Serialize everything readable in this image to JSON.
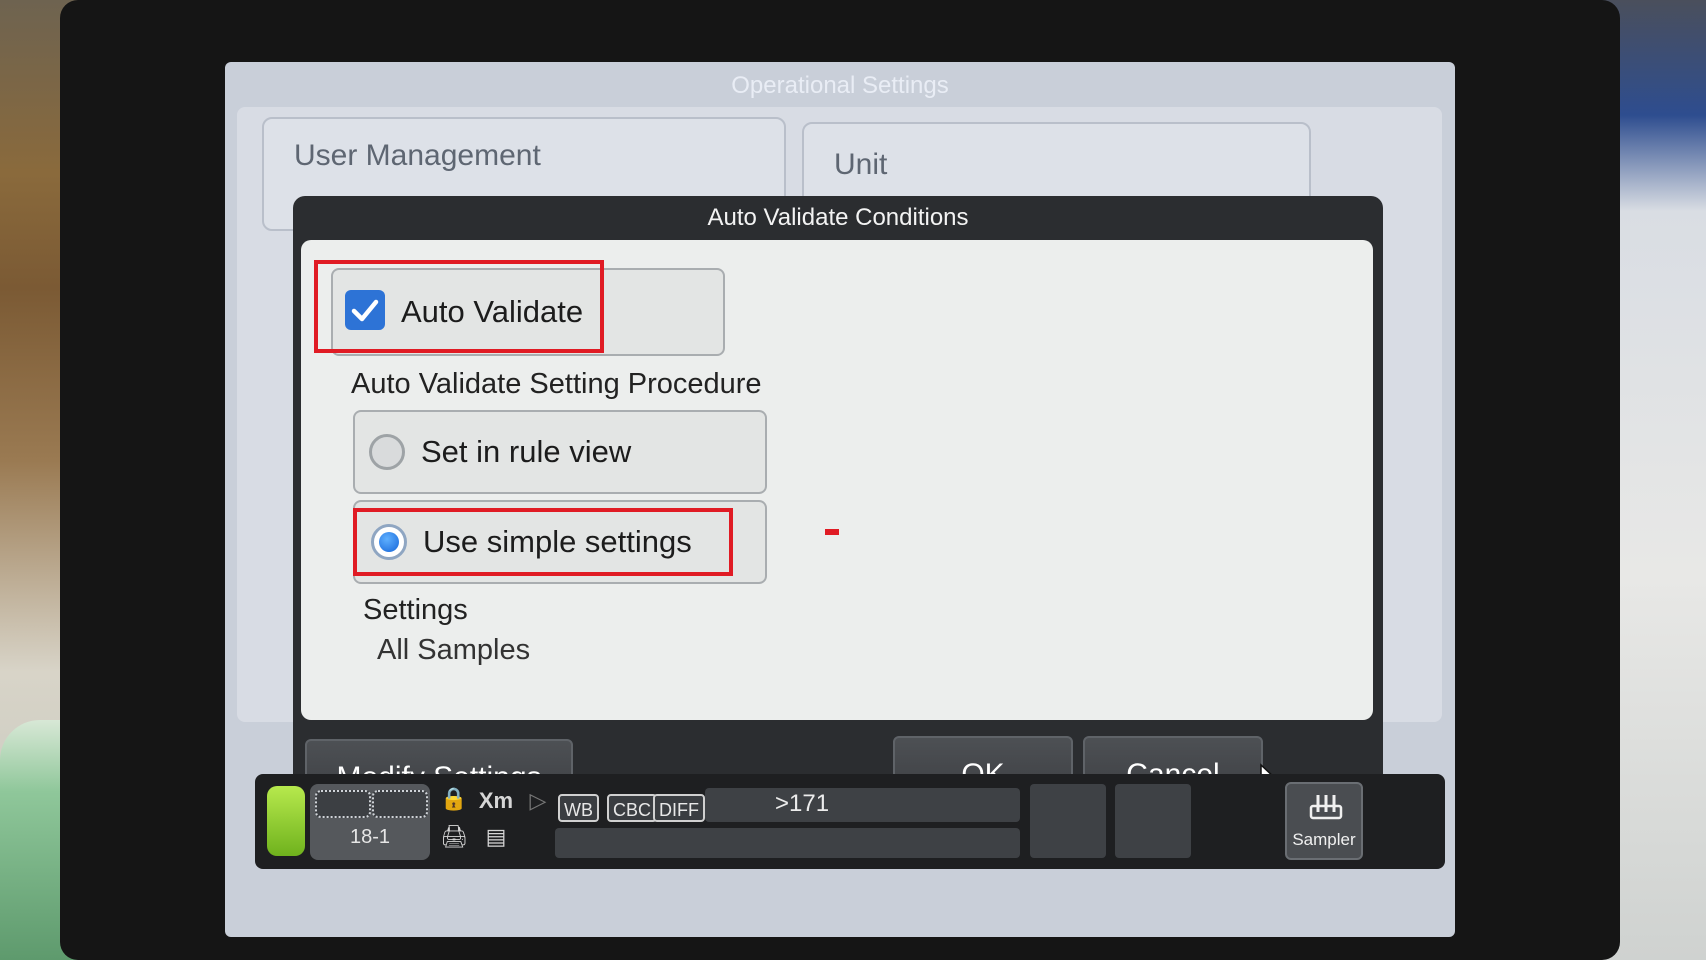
{
  "screen_title": "Operational Settings",
  "background_tiles": {
    "user_management": "User Management",
    "unit": "Unit"
  },
  "dialog": {
    "title": "Auto Validate Conditions",
    "auto_validate": {
      "label": "Auto Validate",
      "checked": true
    },
    "procedure_heading": "Auto Validate Setting Procedure",
    "procedure_options": [
      {
        "label": "Set in rule view",
        "selected": false
      },
      {
        "label": "Use simple settings",
        "selected": true
      }
    ],
    "settings_heading": "Settings",
    "settings_value": "All Samples",
    "buttons": {
      "modify": "Modify Settings",
      "ok": "OK",
      "cancel": "Cancel"
    }
  },
  "status_bar": {
    "rack_position": "18-1",
    "mode_tags": [
      "WB",
      "CBC",
      "DIFF"
    ],
    "xm_label": "Xm",
    "sample_count": ">171",
    "sampler_label": "Sampler"
  },
  "colors": {
    "highlight": "#e01b24",
    "checkbox_accent": "#2d73d6",
    "status_led": "#8fcb2a"
  }
}
